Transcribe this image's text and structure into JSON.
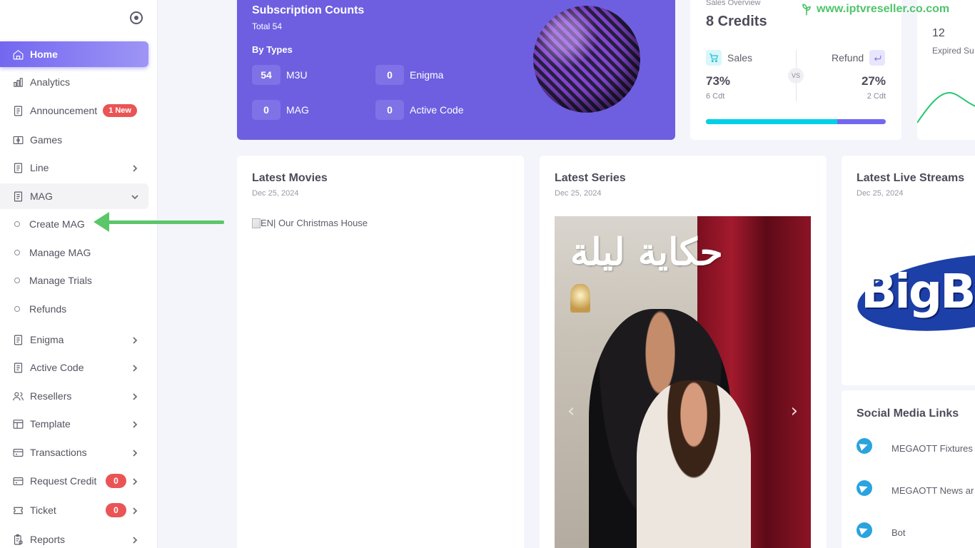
{
  "sidebar": {
    "items": [
      {
        "label": "Home"
      },
      {
        "label": "Analytics"
      },
      {
        "label": "Announcement",
        "badge": "1 New"
      },
      {
        "label": "Games"
      },
      {
        "label": "Line"
      },
      {
        "label": "MAG"
      },
      {
        "label": "Enigma"
      },
      {
        "label": "Active Code"
      },
      {
        "label": "Resellers"
      },
      {
        "label": "Template"
      },
      {
        "label": "Transactions"
      },
      {
        "label": "Request Credit",
        "badge": "0"
      },
      {
        "label": "Ticket",
        "badge": "0"
      },
      {
        "label": "Reports"
      }
    ],
    "mag_sub": [
      "Create MAG",
      "Manage MAG",
      "Manage Trials",
      "Refunds"
    ]
  },
  "subscription": {
    "title": "Subscription Counts",
    "total": "Total 54",
    "by_types": "By Types",
    "stats": [
      {
        "value": "54",
        "label": "M3U"
      },
      {
        "value": "0",
        "label": "Enigma"
      },
      {
        "value": "0",
        "label": "MAG"
      },
      {
        "value": "0",
        "label": "Active Code"
      }
    ]
  },
  "sales": {
    "label": "Sales Overview",
    "credits": "8 Credits",
    "sales_label": "Sales",
    "refund_label": "Refund",
    "vs": "VS",
    "sales_pct": "73%",
    "refund_pct": "27%",
    "sales_cdt": "6 Cdt",
    "refund_cdt": "2 Cdt",
    "sales_fraction": 0.73
  },
  "expired": {
    "count": "12",
    "label": "Expired Su"
  },
  "watermark": "www.iptvreseller.co.com",
  "movies": {
    "title": "Latest Movies",
    "date": "Dec 25, 2024",
    "image_alt": "EN| Our Christmas House"
  },
  "series": {
    "title": "Latest Series",
    "date": "Dec 25, 2024",
    "poster_text": "حكاية ليلة",
    "prev": "‹",
    "next": "›"
  },
  "live": {
    "title": "Latest Live Streams",
    "date": "Dec 25, 2024",
    "logo_text": "BigBr"
  },
  "social": {
    "title": "Social Media Links",
    "links": [
      "MEGAOTT Fixtures",
      "MEGAOTT News ar",
      "Bot"
    ]
  },
  "colors": {
    "accent": "#7367f0",
    "card_purple": "#6d5fe0",
    "cyan": "#00cfe8",
    "danger": "#ea5455",
    "annotation_green": "#5cc66a"
  }
}
